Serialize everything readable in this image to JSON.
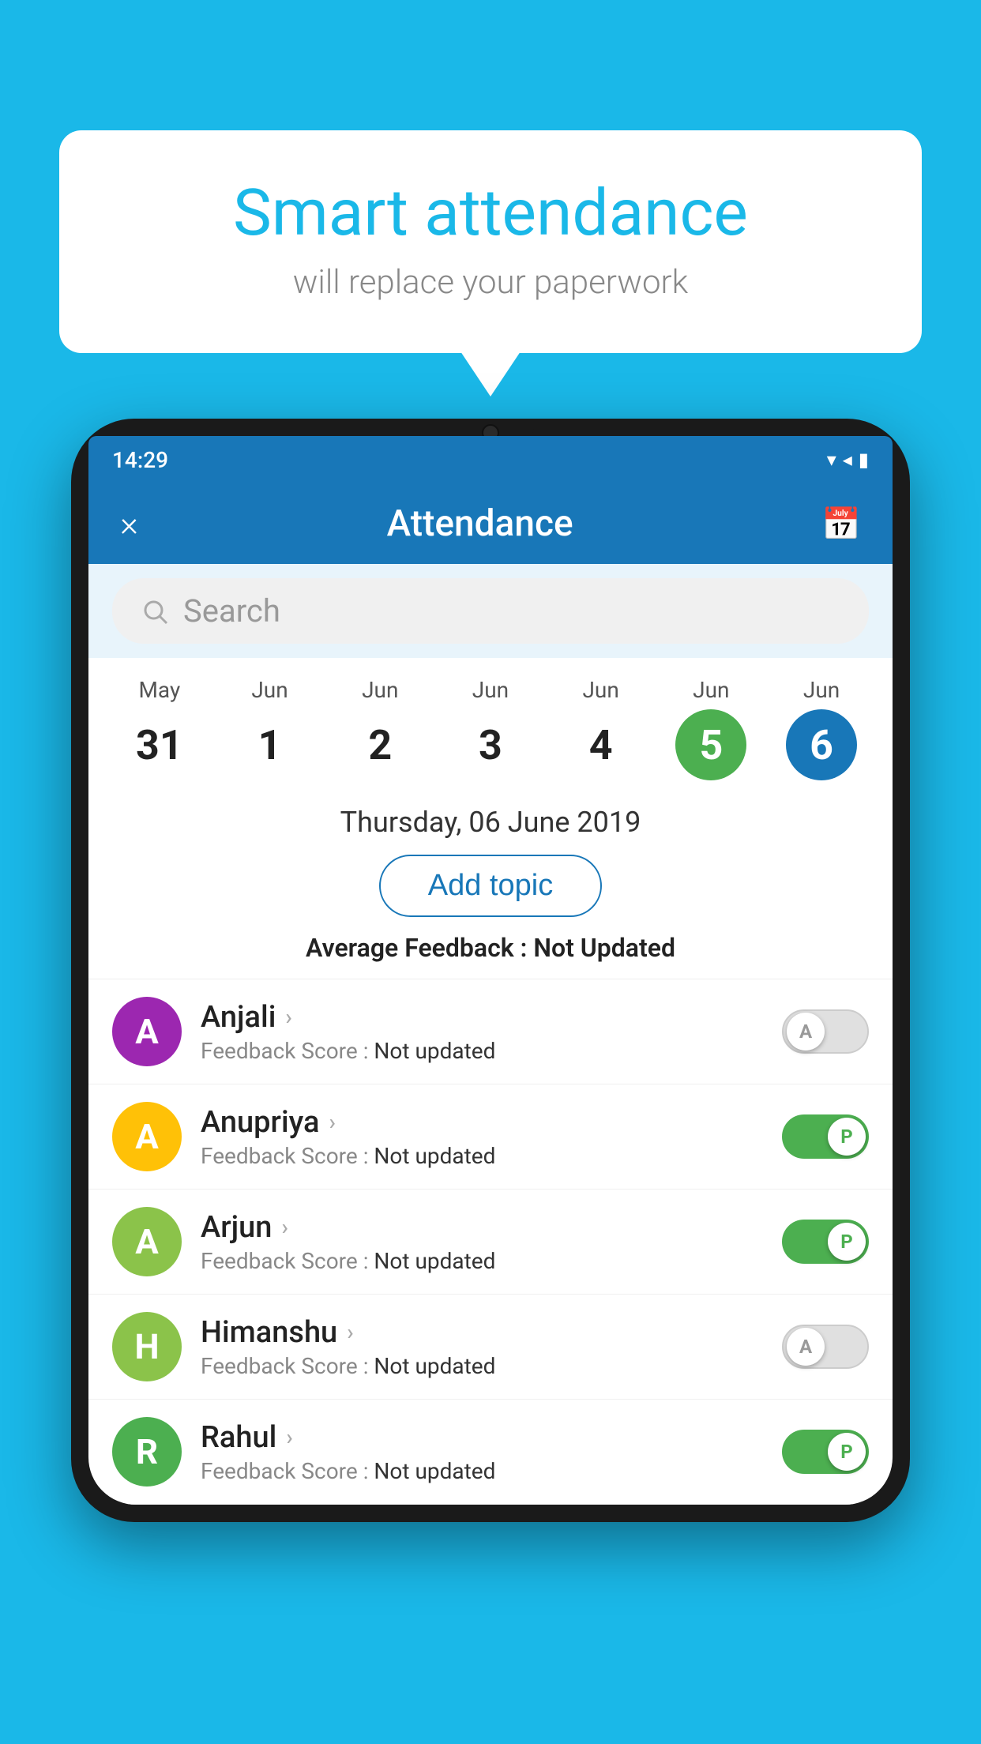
{
  "background_color": "#1ab8e8",
  "speech_bubble": {
    "title": "Smart attendance",
    "subtitle": "will replace your paperwork"
  },
  "phone": {
    "status_bar": {
      "time": "14:29",
      "icons": [
        "wifi",
        "signal",
        "battery"
      ]
    },
    "header": {
      "title": "Attendance",
      "close_label": "×",
      "calendar_icon": "📅"
    },
    "search": {
      "placeholder": "Search"
    },
    "calendar": {
      "days": [
        {
          "month": "May",
          "num": "31",
          "state": "normal"
        },
        {
          "month": "Jun",
          "num": "1",
          "state": "normal"
        },
        {
          "month": "Jun",
          "num": "2",
          "state": "normal"
        },
        {
          "month": "Jun",
          "num": "3",
          "state": "normal"
        },
        {
          "month": "Jun",
          "num": "4",
          "state": "normal"
        },
        {
          "month": "Jun",
          "num": "5",
          "state": "today"
        },
        {
          "month": "Jun",
          "num": "6",
          "state": "selected"
        }
      ]
    },
    "selected_date": "Thursday, 06 June 2019",
    "add_topic_label": "Add topic",
    "avg_feedback": {
      "label": "Average Feedback : ",
      "value": "Not Updated"
    },
    "students": [
      {
        "name": "Anjali",
        "avatar_letter": "A",
        "avatar_color": "#9c27b0",
        "feedback": "Not updated",
        "toggle_state": "off",
        "toggle_letter": "A"
      },
      {
        "name": "Anupriya",
        "avatar_letter": "A",
        "avatar_color": "#ffc107",
        "feedback": "Not updated",
        "toggle_state": "on-p",
        "toggle_letter": "P"
      },
      {
        "name": "Arjun",
        "avatar_letter": "A",
        "avatar_color": "#8bc34a",
        "feedback": "Not updated",
        "toggle_state": "on-p",
        "toggle_letter": "P"
      },
      {
        "name": "Himanshu",
        "avatar_letter": "H",
        "avatar_color": "#8bc34a",
        "feedback": "Not updated",
        "toggle_state": "off",
        "toggle_letter": "A"
      },
      {
        "name": "Rahul",
        "avatar_letter": "R",
        "avatar_color": "#4caf50",
        "feedback": "Not updated",
        "toggle_state": "on-p",
        "toggle_letter": "P"
      }
    ]
  }
}
